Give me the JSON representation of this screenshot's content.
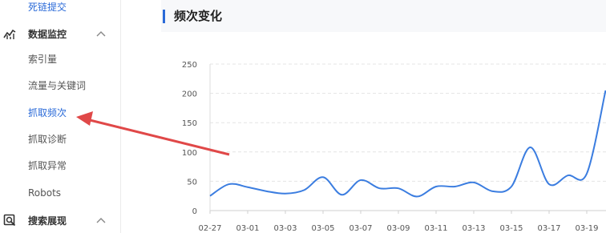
{
  "sidebar": {
    "top_link": "死链提交",
    "groups": [
      {
        "label": "数据监控",
        "icon": "chart-line-icon",
        "items": [
          "索引量",
          "流量与关键词",
          "抓取频次",
          "抓取诊断",
          "抓取异常",
          "Robots"
        ],
        "active_index": 2
      },
      {
        "label": "搜索展现",
        "icon": "search-display-icon",
        "items": []
      }
    ],
    "accent_color": "#2a6ad8"
  },
  "main": {
    "section_title": "频次变化"
  },
  "chart_data": {
    "type": "line",
    "title": "",
    "xlabel": "",
    "ylabel": "",
    "ylim": [
      0,
      250
    ],
    "yticks": [
      0,
      50,
      100,
      150,
      200,
      250
    ],
    "xtick_labels": [
      "02-27",
      "03-01",
      "03-03",
      "03-05",
      "03-07",
      "03-09",
      "03-11",
      "03-13",
      "03-15",
      "03-17",
      "03-19"
    ],
    "grid": true,
    "line_color": "#3b7de0",
    "x": [
      "02-27",
      "02-28",
      "03-01",
      "03-02",
      "03-03",
      "03-04",
      "03-05",
      "03-06",
      "03-07",
      "03-08",
      "03-09",
      "03-10",
      "03-11",
      "03-12",
      "03-13",
      "03-14",
      "03-15",
      "03-16",
      "03-17",
      "03-18",
      "03-19",
      "03-20"
    ],
    "values": [
      25,
      45,
      40,
      33,
      29,
      35,
      57,
      27,
      52,
      38,
      38,
      24,
      41,
      41,
      48,
      33,
      41,
      108,
      45,
      60,
      63,
      205
    ]
  }
}
